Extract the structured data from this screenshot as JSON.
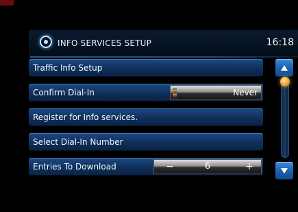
{
  "header": {
    "title": "INFO SERVICES SETUP",
    "clock": "16:18",
    "icon": "info-services-icon"
  },
  "menu": {
    "items": [
      {
        "label": "Traffic Info Setup"
      },
      {
        "label": "Confirm Dial-In",
        "value": "Never"
      },
      {
        "label": "Register for Info services."
      },
      {
        "label": "Select Dial-In Number"
      },
      {
        "label": "Entries To Download",
        "minus": "−",
        "count": "6",
        "plus": "+"
      }
    ]
  },
  "scrollbar": {
    "up_icon": "arrow-up-icon",
    "down_icon": "arrow-down-icon",
    "position": 0
  },
  "colors": {
    "row_blue": "#1c4b84",
    "accent_orange": "#f2a531",
    "button_blue": "#1a5fae"
  }
}
